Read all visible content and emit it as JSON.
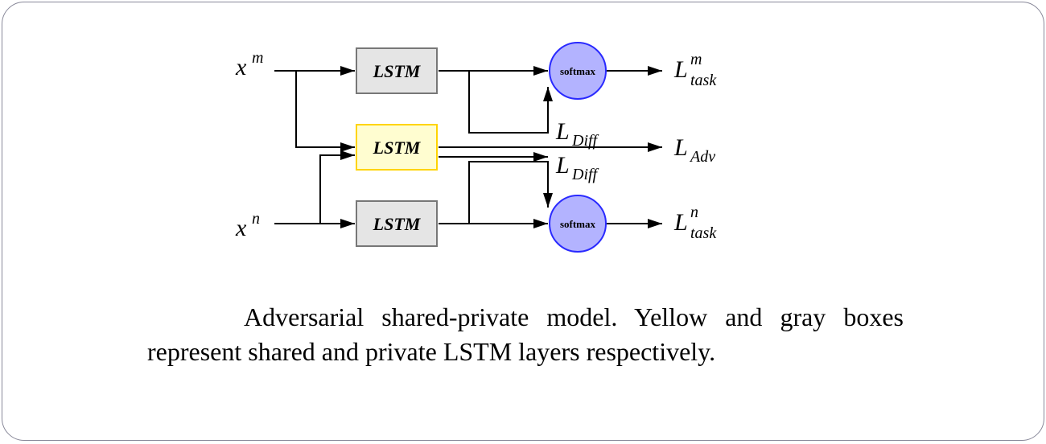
{
  "diagram": {
    "inputs": {
      "top": {
        "base": "x",
        "sup": "m"
      },
      "bottom": {
        "base": "x",
        "sup": "n"
      }
    },
    "nodes": {
      "lstm_top": {
        "label": "LSTM",
        "fill": "#e5e5e5",
        "stroke": "#777777"
      },
      "lstm_mid": {
        "label": "LSTM",
        "fill": "#fffdd0",
        "stroke": "#ffd400"
      },
      "lstm_bot": {
        "label": "LSTM",
        "fill": "#e5e5e5",
        "stroke": "#777777"
      },
      "softmax_top": {
        "label": "softmax",
        "fill": "#b3b3ff",
        "stroke": "#2a2aff"
      },
      "softmax_bot": {
        "label": "softmax",
        "fill": "#b3b3ff",
        "stroke": "#2a2aff"
      }
    },
    "outputs": {
      "task_top": {
        "base": "L",
        "sup": "m",
        "sub": "task"
      },
      "adv": {
        "base": "L",
        "sub": "Adv"
      },
      "diff_top": {
        "base": "L",
        "sub": "Diff"
      },
      "diff_bot": {
        "base": "L",
        "sub": "Diff"
      },
      "task_bot": {
        "base": "L",
        "sup": "n",
        "sub": "task"
      }
    }
  },
  "caption": {
    "line": "Adversarial shared-private model. Yellow and gray boxes represent shared and private LSTM layers respectively."
  }
}
